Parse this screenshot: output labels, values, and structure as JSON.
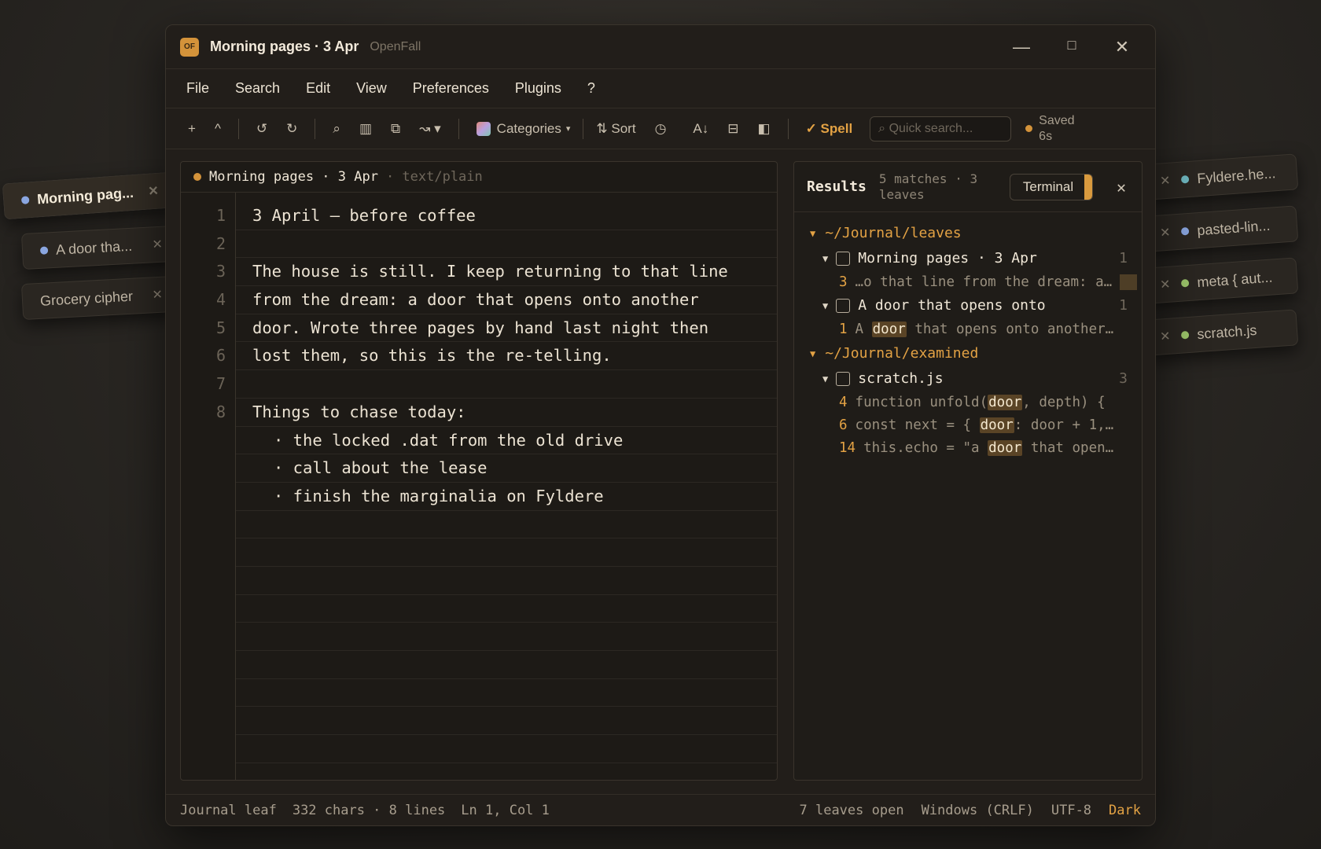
{
  "window": {
    "logo": "OF",
    "title": "Morning pages · 3 Apr",
    "app_name": "OpenFall"
  },
  "menu": [
    "File",
    "Search",
    "Edit",
    "View",
    "Preferences",
    "Plugins",
    "?"
  ],
  "toolbar": {
    "new": "+",
    "up": "^",
    "undo": "↺",
    "redo": "↻",
    "find": "⌕",
    "columns": "▥",
    "duplicate": "⧉",
    "wrap": "↝ ▾",
    "categories": "Categories",
    "sort": "⇅ Sort",
    "history": "◷",
    "az": "A↓",
    "split": "⊟",
    "panel": "◧",
    "spell": "✓ Spell",
    "search_placeholder": "⌕ Quick search...",
    "saved_line1": "Saved",
    "saved_line2": "6s"
  },
  "left_tabs": [
    {
      "label": "Morning pag...",
      "dot": "#8aa6e0",
      "active": true
    },
    {
      "label": "A door tha...",
      "dot": "#8aa6e0",
      "active": false
    },
    {
      "label": "Grocery cipher",
      "dot": null,
      "active": false
    }
  ],
  "right_tabs": [
    {
      "label": "Fyldere.he...",
      "dot": "#6fb8c0"
    },
    {
      "label": "pasted-lin...",
      "dot": "#8aa6e0"
    },
    {
      "label": "meta { aut...",
      "dot": "#9cc46a"
    },
    {
      "label": "scratch.js",
      "dot": "#9cc46a"
    }
  ],
  "editor": {
    "file_title": "Morning pages · 3 Apr",
    "mime": "· text/plain",
    "line_numbers": [
      "1",
      "2",
      "3",
      "4",
      "5",
      "6",
      "7",
      "8"
    ],
    "lines": [
      "3 April — before coffee",
      "",
      "The house is still. I keep returning to that line",
      "from the dream: a door that opens onto another",
      "door. Wrote three pages by hand last night then",
      "lost them, so this is the re-telling.",
      "",
      "Things to chase today:"
    ],
    "bullets": [
      "· the locked .dat from the old drive",
      "· call about the lease",
      "· finish the marginalia on Fyldere"
    ]
  },
  "results": {
    "title": "Results",
    "summary": "5 matches · 3 leaves",
    "terminal": "Terminal",
    "close": "✕",
    "groups": [
      {
        "path": "~/Journal/leaves",
        "files": [
          {
            "name": "Morning pages · 3 Apr",
            "count": "1",
            "matches": [
              {
                "line": "3",
                "pre": "…o that line from the dream: a…",
                "hl": "",
                "post": ""
              }
            ]
          },
          {
            "name": "A door that opens onto",
            "count": "1",
            "matches": [
              {
                "line": "1",
                "pre": "A ",
                "hl": "door",
                "post": " that opens onto another…"
              }
            ]
          }
        ]
      },
      {
        "path": "~/Journal/examined",
        "files": [
          {
            "name": "scratch.js",
            "count": "3",
            "matches": [
              {
                "line": "4",
                "pre": "function unfold(",
                "hl": "door",
                "post": ", depth) {"
              },
              {
                "line": "6",
                "pre": "const next = { ",
                "hl": "door",
                "post": ": door + 1,…"
              },
              {
                "line": "14",
                "pre": "this.echo = \"a ",
                "hl": "door",
                "post": " that open…"
              }
            ]
          }
        ]
      }
    ]
  },
  "status": {
    "mode": "Journal leaf",
    "stats": "332 chars · 8 lines",
    "cursor": "Ln 1, Col 1",
    "open": "7 leaves open",
    "eol": "Windows (CRLF)",
    "encoding": "UTF-8",
    "theme": "Dark"
  }
}
